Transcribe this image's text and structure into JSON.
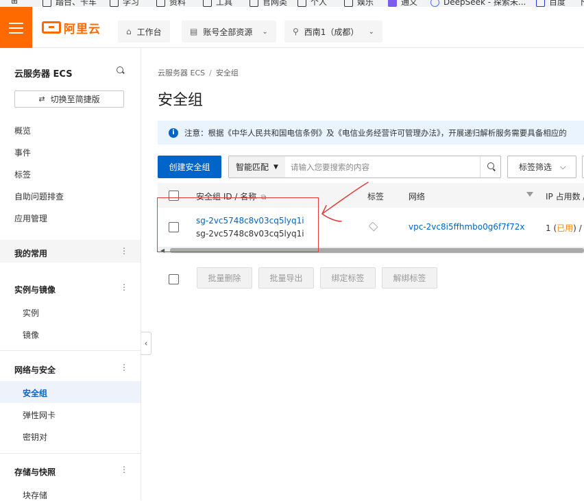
{
  "bookmarks": [
    {
      "label": "",
      "icon": "apps-grid-icon"
    },
    {
      "label": "踏台、卡车",
      "icon": "folder-icon"
    },
    {
      "label": "学习",
      "icon": "folder-icon"
    },
    {
      "label": "资料",
      "icon": "folder-icon"
    },
    {
      "label": "工具",
      "icon": "folder-icon"
    },
    {
      "label": "官网类",
      "icon": "folder-icon"
    },
    {
      "label": "个人",
      "icon": "folder-icon"
    },
    {
      "label": "娱乐",
      "icon": "folder-icon"
    },
    {
      "label": "通义",
      "icon": "tongyi-icon"
    },
    {
      "label": "DeepSeek - 探索未...",
      "icon": "deepseek-icon"
    },
    {
      "label": "百度",
      "icon": "baidu-icon"
    },
    {
      "label": "下",
      "icon": "folder-icon"
    }
  ],
  "topbar": {
    "brand": "阿里云",
    "workbench": "工作台",
    "account_scope": "账号全部资源",
    "region": "西南1（成都）",
    "accent_color": "#ff6a00"
  },
  "sidebar": {
    "title": "云服务器 ECS",
    "switch_label": "切换至简捷版",
    "items": [
      "概览",
      "事件",
      "标签",
      "自助问题排查",
      "应用管理"
    ],
    "favorites": "我的常用",
    "groups": [
      {
        "title": "实例与镜像",
        "items": [
          "实例",
          "镜像"
        ]
      },
      {
        "title": "网络与安全",
        "items": [
          "安全组",
          "弹性网卡",
          "密钥对"
        ]
      },
      {
        "title": "存储与快照",
        "items": [
          "块存储"
        ]
      }
    ],
    "active_item": "安全组"
  },
  "main": {
    "breadcrumb": [
      "云服务器 ECS",
      "安全组"
    ],
    "breadcrumb_sep": "/",
    "page_title": "安全组",
    "notice": "注意：根据《中华人民共和国电信条例》及《电信业务经营许可管理办法》，开展递归解析服务需要具备相应的",
    "create_button": "创建安全组",
    "search_mode": "智能匹配",
    "search_placeholder": "请输入您要搜索的内容",
    "tag_filter": "标签筛选",
    "primary_color": "#0064c8"
  },
  "table": {
    "headers": {
      "id_name": "安全组 ID / 名称",
      "tags": "标签",
      "network": "网络",
      "ip_usage": "IP 占用数 /"
    },
    "rows": [
      {
        "id": "sg-2vc5748c8v03cq5lyq1i",
        "name": "sg-2vc5748c8v03cq5lyq1i",
        "vpc": "vpc-2vc8i5ffhmbo0g6f7f72x",
        "ip_count": "1",
        "ip_status": "已用",
        "ip_suffix": "/"
      }
    ]
  },
  "batch_actions": [
    "批量删除",
    "批量导出",
    "绑定标签",
    "解绑标签"
  ],
  "annotation": {
    "color": "#e53935"
  }
}
